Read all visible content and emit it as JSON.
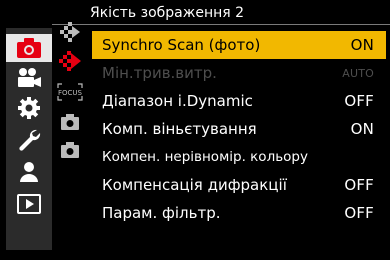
{
  "header": {
    "title": "Якість зображення 2"
  },
  "categories": [
    {
      "id": "photo",
      "icon": "camera-icon",
      "active": true
    },
    {
      "id": "video",
      "icon": "video-camera-icon",
      "active": false
    },
    {
      "id": "custom",
      "icon": "gear-icon",
      "active": false
    },
    {
      "id": "setup",
      "icon": "wrench-icon",
      "active": false
    },
    {
      "id": "mymenu",
      "icon": "person-icon",
      "active": false
    },
    {
      "id": "playback",
      "icon": "playback-icon",
      "active": false
    }
  ],
  "subtabs": [
    {
      "icon": "image-quality-1-icon",
      "active": false
    },
    {
      "icon": "image-quality-2-icon",
      "active": true
    },
    {
      "icon": "focus-icon",
      "active": false,
      "label": "FOCUS"
    },
    {
      "icon": "camera-sub-icon-1",
      "active": false
    },
    {
      "icon": "camera-sub-icon-2",
      "active": false
    }
  ],
  "menu": {
    "items": [
      {
        "label": "Synchro Scan (фото)",
        "value": "ON",
        "state": "selected"
      },
      {
        "label": "Мін.трив.витр.",
        "value": "AUTO",
        "state": "disabled"
      },
      {
        "label": "Діапазон і.Dynamic",
        "value": "OFF",
        "state": "normal"
      },
      {
        "label": "Комп. віньєтування",
        "value": "ON",
        "state": "normal"
      },
      {
        "label": "Компен. нерівномір. кольору",
        "value": "",
        "state": "normal"
      },
      {
        "label": "Компенсація дифракції",
        "value": "OFF",
        "state": "normal"
      },
      {
        "label": "Парам. фільтр.",
        "value": "OFF",
        "state": "normal"
      }
    ]
  },
  "colors": {
    "selected_bg": "#f2b800",
    "active_icon": "#e60012",
    "sidebar_bg": "#2b2b2b"
  }
}
